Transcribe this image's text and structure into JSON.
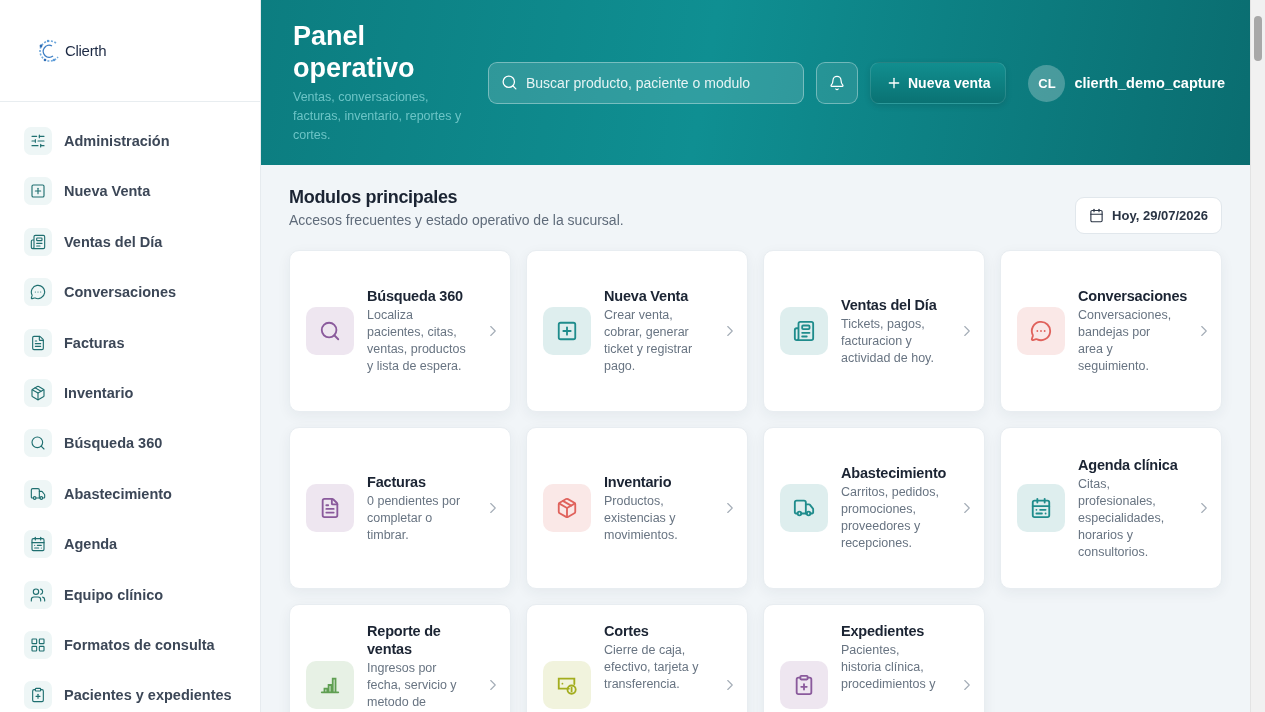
{
  "brand": {
    "name": "Clierth"
  },
  "sidebar": {
    "items": [
      {
        "label": "Administración"
      },
      {
        "label": "Nueva Venta"
      },
      {
        "label": "Ventas del Día"
      },
      {
        "label": "Conversaciones"
      },
      {
        "label": "Facturas"
      },
      {
        "label": "Inventario"
      },
      {
        "label": "Búsqueda 360"
      },
      {
        "label": "Abastecimiento"
      },
      {
        "label": "Agenda"
      },
      {
        "label": "Equipo clínico"
      },
      {
        "label": "Formatos de consulta"
      },
      {
        "label": "Pacientes y expedientes"
      }
    ]
  },
  "header": {
    "title": "Panel operativo",
    "subtitle": "Ventas, conversaciones, facturas, inventario, reportes y cortes.",
    "search": {
      "placeholder": "Buscar producto, paciente o modulo"
    },
    "new_sale": "Nueva venta",
    "user": {
      "initials": "CL",
      "name": "clierth_demo_capture"
    }
  },
  "section": {
    "title": "Modulos principales",
    "subtitle": "Accesos frecuentes y estado operativo de la sucursal.",
    "date": "Hoy, 29/07/2026"
  },
  "modules": [
    {
      "title": "Búsqueda 360",
      "description": "Localiza pacientes, citas, ventas, productos y lista de espera.",
      "color": "#8a5a9c"
    },
    {
      "title": "Nueva Venta",
      "description": "Crear venta, cobrar, generar ticket y registrar pago.",
      "color": "#1f8c8c"
    },
    {
      "title": "Ventas del Día",
      "description": "Tickets, pagos, facturacion y actividad de hoy.",
      "color": "#1f8c8c"
    },
    {
      "title": "Conversaciones",
      "description": "Conversaciones, bandejas por area y seguimiento.",
      "color": "#e0625c"
    },
    {
      "title": "Facturas",
      "description": "0 pendientes por completar o timbrar.",
      "color": "#8a5a9c"
    },
    {
      "title": "Inventario",
      "description": "Productos, existencias y movimientos.",
      "color": "#e0625c"
    },
    {
      "title": "Abastecimiento",
      "description": "Carritos, pedidos, promociones, proveedores y recepciones.",
      "color": "#1f8c8c"
    },
    {
      "title": "Agenda clínica",
      "description": "Citas, profesionales, especialidades, horarios y consultorios.",
      "color": "#1f8c8c"
    },
    {
      "title": "Reporte de ventas",
      "description": "Ingresos por fecha, servicio y metodo de",
      "color": "#5f9f52"
    },
    {
      "title": "Cortes",
      "description": "Cierre de caja, efectivo, tarjeta y transferencia.",
      "color": "#a3ad1e"
    },
    {
      "title": "Expedientes",
      "description": "Pacientes, historia clínica, procedimientos y",
      "color": "#8a5a9c"
    }
  ]
}
